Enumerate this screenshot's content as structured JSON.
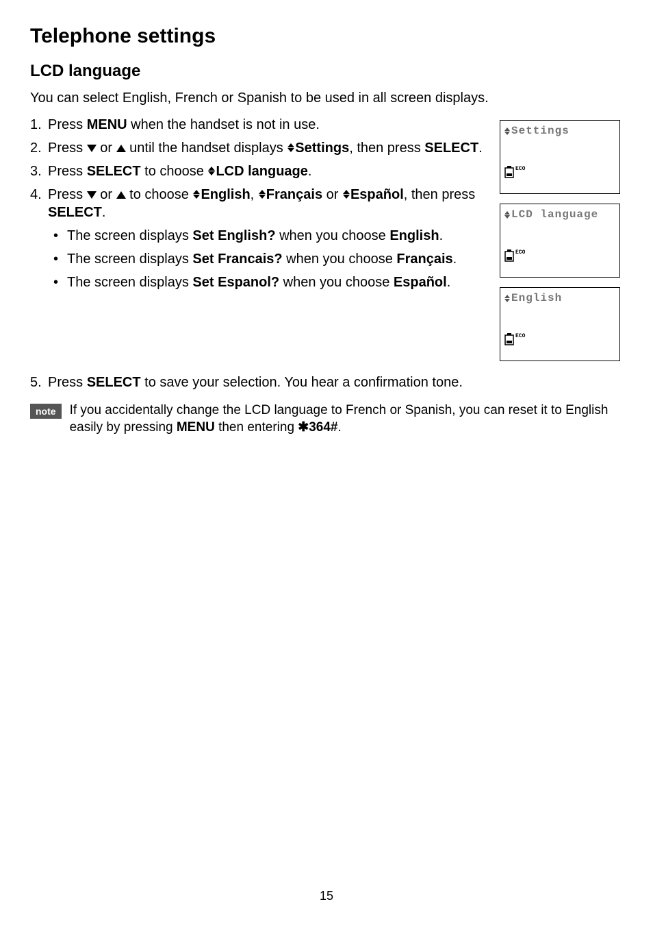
{
  "title": "Telephone settings",
  "section": "LCD language",
  "intro": "You can select English, French or Spanish to be used in all screen displays.",
  "steps": {
    "s1": {
      "num": "1.",
      "pre": "Press ",
      "b1": "MENU",
      "post": " when the handset is not in use."
    },
    "s2": {
      "num": "2.",
      "pre": "Press ",
      "mid": " or ",
      "post1": " until the handset displays ",
      "b1": "Settings",
      "post2": ", then press ",
      "b2": "SELECT",
      "end": "."
    },
    "s3": {
      "num": "3.",
      "pre": "Press ",
      "b1": "SELECT",
      "mid": " to choose ",
      "b2": "LCD language",
      "end": "."
    },
    "s4": {
      "num": "4.",
      "pre": "Press ",
      "mid": " or ",
      "post1": " to choose ",
      "b1": "English",
      "c1": ", ",
      "b2": "Français",
      "c2": " or ",
      "b3": "Español",
      "post2": ", then press ",
      "b4": "SELECT",
      "end": "."
    },
    "s5": {
      "num": "5.",
      "pre": "Press ",
      "b1": "SELECT",
      "post": " to save your selection. You hear a confirmation tone."
    }
  },
  "bullets": {
    "b1": {
      "pre": "The screen displays ",
      "bold": "Set English?",
      "mid": " when you choose ",
      "bold2": "English",
      "end": "."
    },
    "b2": {
      "pre": "The screen displays ",
      "bold": "Set Francais?",
      "mid": " when you choose ",
      "bold2": "Français",
      "end": "."
    },
    "b3": {
      "pre": "The screen displays ",
      "bold": "Set Espanol?",
      "mid": " when you choose ",
      "bold2": "Español",
      "end": "."
    }
  },
  "note": {
    "tag": "note",
    "pre": "If you accidentally change the LCD language to French or Spanish, you can reset it to English easily by pressing ",
    "b1": "MENU",
    "mid": " then entering ",
    "b2": "364#",
    "end": "."
  },
  "lcd": {
    "l1": "Settings",
    "l2": "LCD language",
    "l3": "English",
    "eco": "ECO"
  },
  "pageNumber": "15"
}
